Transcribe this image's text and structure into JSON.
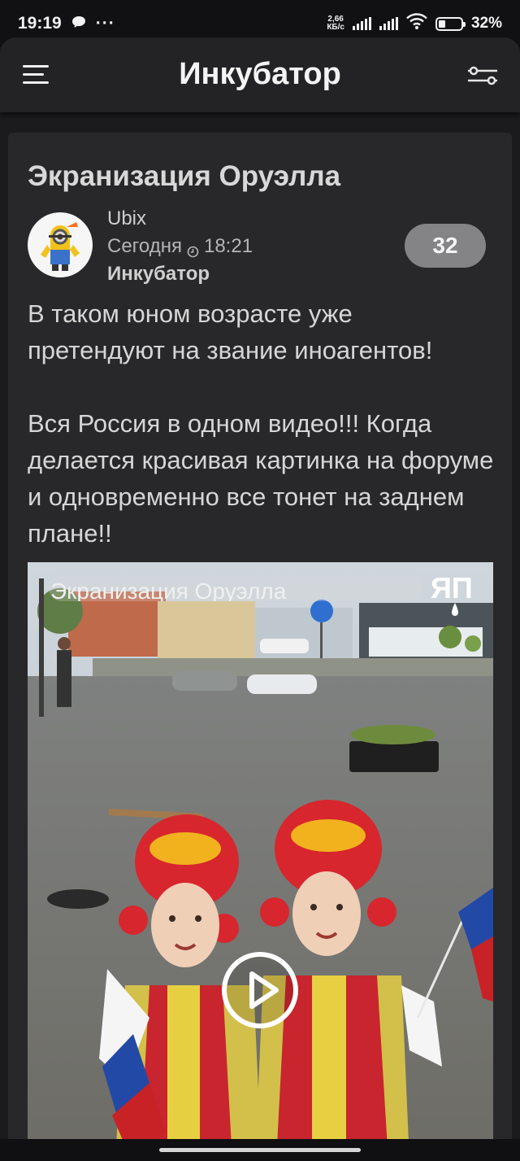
{
  "status_bar": {
    "time": "19:19",
    "net_speed_value": "2,66",
    "net_speed_unit": "КБ/с",
    "battery_percent": "32%",
    "battery_level": 0.32
  },
  "header": {
    "title": "Инкубатор",
    "menu_icon": "hamburger-icon",
    "filter_icon": "filter-sliders-icon"
  },
  "post": {
    "title": "Экранизация Оруэлла",
    "author": "Ubix",
    "date": "Сегодня",
    "time": "18:21",
    "community": "Инкубатор",
    "rating": "32",
    "paragraphs": [
      "В таком юном возрасте уже претендуют на звание иноагентов!",
      "Вся Россия в одном видео!!! Когда делается красивая картинка на форуме и одновременно все тонет на заднем плане!!"
    ],
    "video": {
      "overlay_title": "Экранизация Оруэлла",
      "watermark": "ЯП",
      "play_icon": "play-icon"
    }
  }
}
